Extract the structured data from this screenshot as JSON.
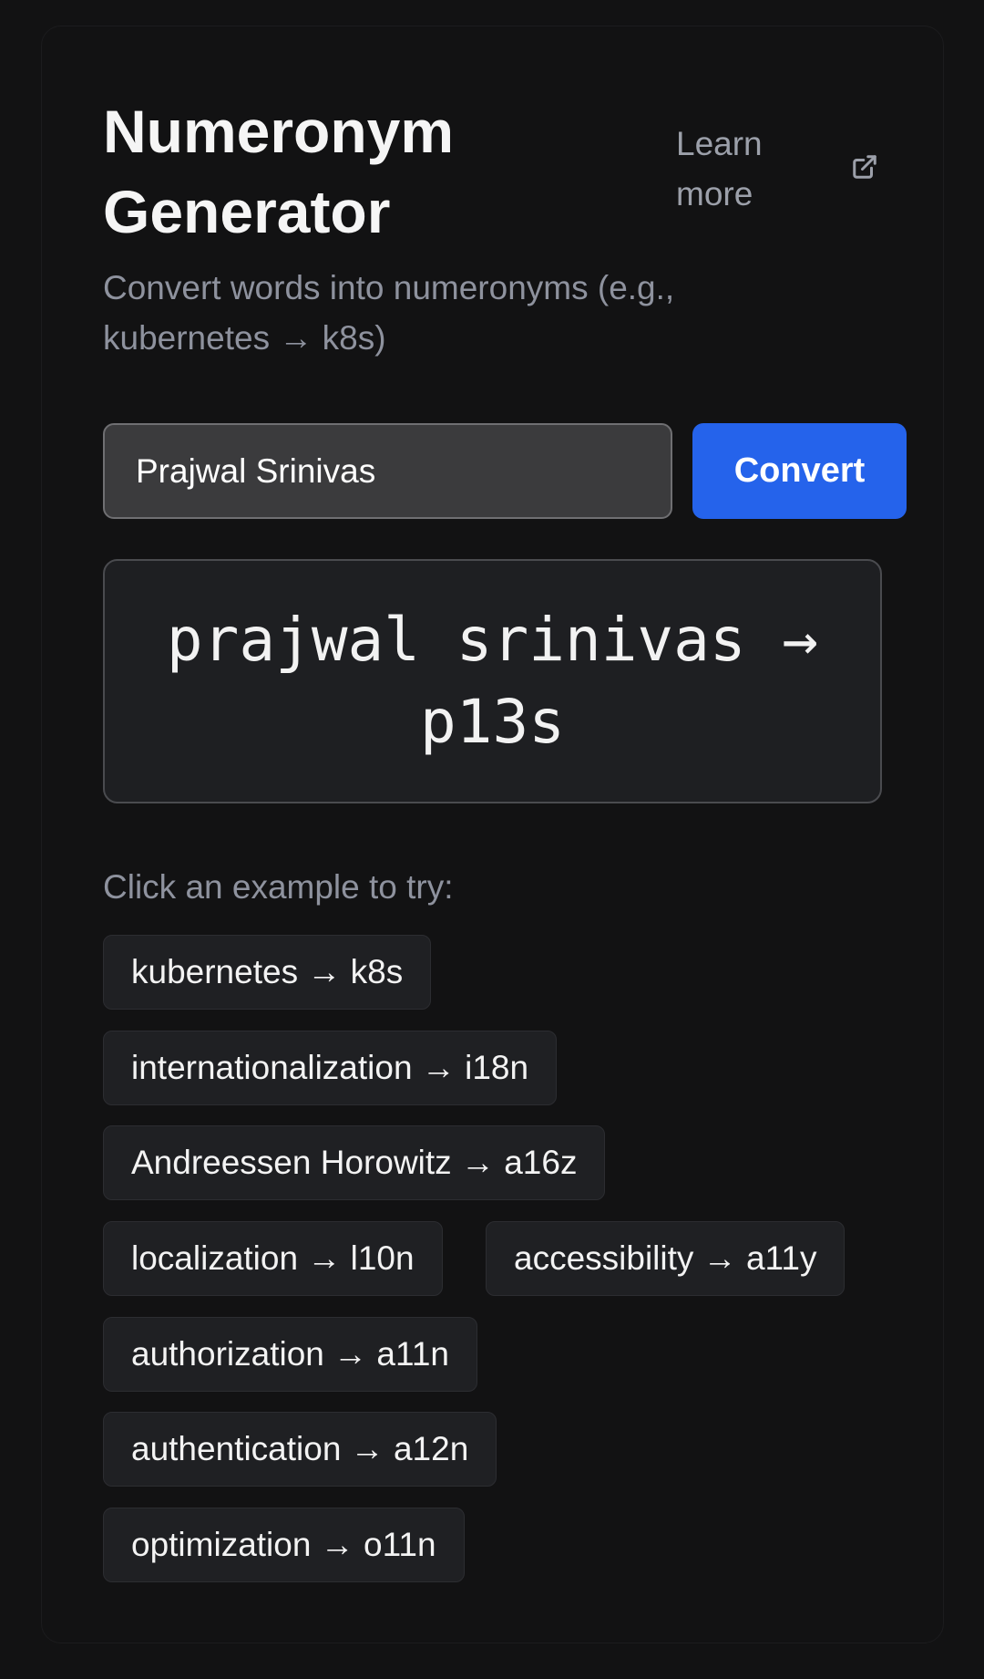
{
  "header": {
    "title": "Numeronym Generator",
    "learn_more_label": "Learn more",
    "learn_more_icon": "external-link-icon"
  },
  "subtitle": "Convert words into numeronyms (e.g., kubernetes → k8s)",
  "form": {
    "input_value": "Prajwal Srinivas",
    "convert_label": "Convert"
  },
  "result": {
    "text": "prajwal srinivas → p13s"
  },
  "examples": {
    "label": "Click an example to try:",
    "items": [
      "kubernetes → k8s",
      "internationalization → i18n",
      "Andreessen Horowitz → a16z",
      "localization → l10n",
      "accessibility → a11y",
      "authorization → a11n",
      "authentication → a12n",
      "optimization → o11n"
    ]
  },
  "colors": {
    "background": "#121213",
    "accent": "#2563eb",
    "muted_text": "#8e929e"
  }
}
